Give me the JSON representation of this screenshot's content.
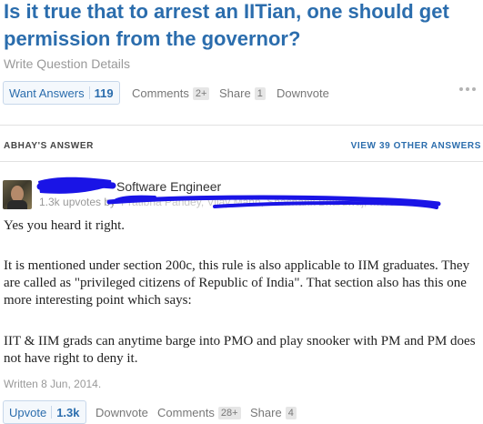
{
  "question": {
    "title": "Is it true that to arrest an IITian, one should get permission from the governor?",
    "details_link": "Write Question Details"
  },
  "question_actions": {
    "want_answers_label": "Want Answers",
    "want_answers_count": "119",
    "comments_label": "Comments",
    "comments_count": "2+",
    "share_label": "Share",
    "share_count": "1",
    "downvote_label": "Downvote"
  },
  "answer_header": {
    "section_label": "ABHAY'S ANSWER",
    "view_other_label": "VIEW 39 OTHER ANSWERS"
  },
  "author": {
    "occupation": "Software Engineer",
    "upvotes_label": "1.3k upvotes by",
    "voter_names": "Pratibha Pandey, Vijay Mann, Shashank Bhardwaj, more",
    "avatar_icon": "person-photo"
  },
  "answer": {
    "p1": "Yes you heard it right.",
    "p2": "It is mentioned under section 200c, this rule is also applicable to IIM graduates. They are called as \"privileged citizens of Republic of India\". That section also has this one more interesting point which says:",
    "p3": "IIT & IIM grads can anytime barge into PMO and play snooker with PM and PM does not have right to deny it.",
    "written": "Written 8 Jun, 2014."
  },
  "answer_actions": {
    "upvote_label": "Upvote",
    "upvote_count": "1.3k",
    "downvote_label": "Downvote",
    "comments_label": "Comments",
    "comments_count": "28+",
    "share_label": "Share",
    "share_count": "4"
  },
  "colors": {
    "link_blue": "#2b6dad",
    "redaction_ink": "#1a14e6"
  }
}
